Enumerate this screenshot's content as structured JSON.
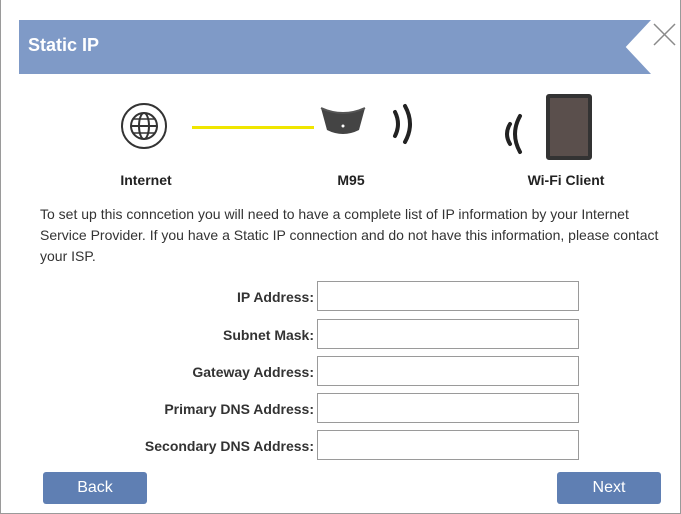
{
  "dialog": {
    "title": "Static IP",
    "close_icon": "close-icon"
  },
  "topology": {
    "internet_label": "Internet",
    "device_label": "M95",
    "client_label": "Wi-Fi Client",
    "link_color": "#f0e600"
  },
  "description": "To set up this conncetion you will need to have a complete list of IP information by your Internet Service Provider. If you have a Static IP connection and do not have this information, please contact your ISP.",
  "form": {
    "fields": [
      {
        "label": "IP Address:",
        "value": ""
      },
      {
        "label": "Subnet Mask:",
        "value": ""
      },
      {
        "label": "Gateway Address:",
        "value": ""
      },
      {
        "label": "Primary DNS Address:",
        "value": ""
      },
      {
        "label": "Secondary DNS Address:",
        "value": ""
      }
    ]
  },
  "buttons": {
    "back": "Back",
    "next": "Next"
  },
  "colors": {
    "title_bar": "#7f9ac7",
    "button": "#5f7fb3"
  }
}
